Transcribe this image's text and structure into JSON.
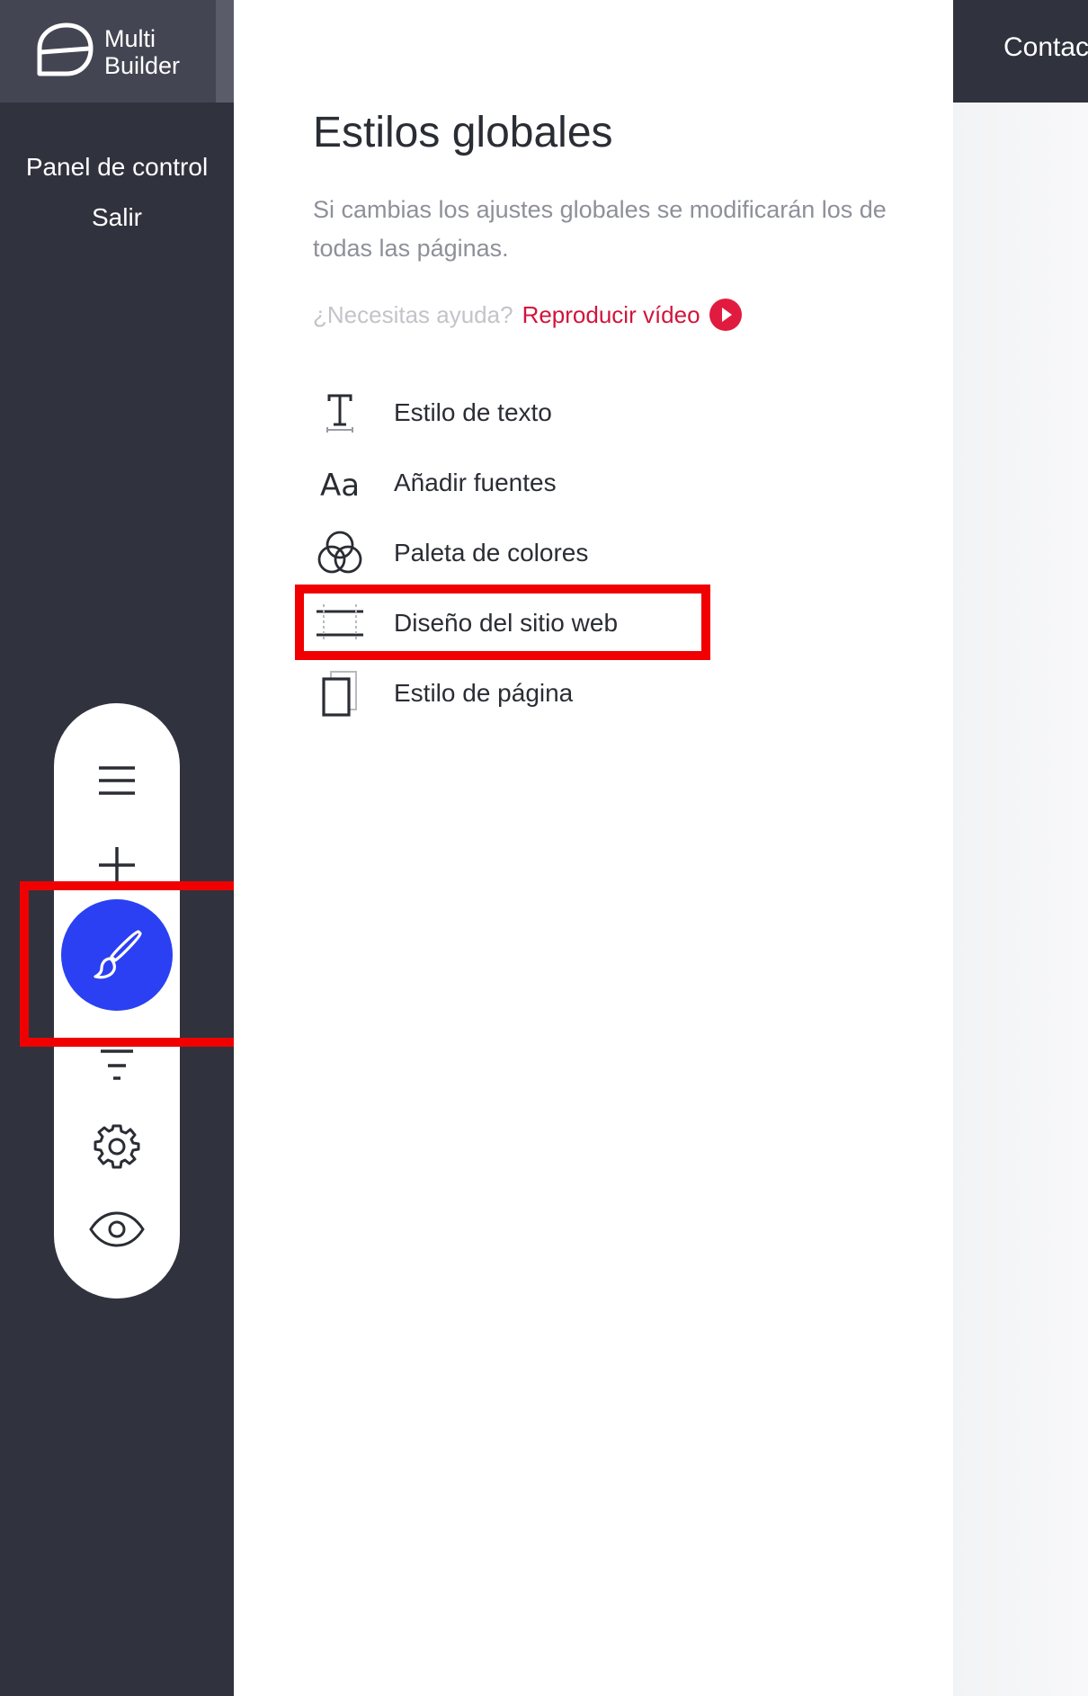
{
  "app": {
    "logo_line1": "Multi",
    "logo_line2": "Builder"
  },
  "sidebar": {
    "links": [
      {
        "label": "Panel de control"
      },
      {
        "label": "Salir"
      }
    ]
  },
  "toolbar": {
    "tools": [
      {
        "icon": "menu-icon"
      },
      {
        "icon": "plus-icon"
      },
      {
        "icon": "brush-icon",
        "active": true
      },
      {
        "icon": "filter-icon"
      },
      {
        "icon": "gear-icon"
      },
      {
        "icon": "eye-icon"
      }
    ],
    "active_color": "#2b40f2"
  },
  "panel": {
    "title": "Estilos globales",
    "description": "Si cambias los ajustes globales se modificarán los de todas las páginas.",
    "help_question": "¿Necesitas ayuda?",
    "help_link": "Reproducir vídeo",
    "items": [
      {
        "label": "Estilo de texto",
        "icon": "text-style-icon"
      },
      {
        "label": "Añadir fuentes",
        "icon": "fonts-icon"
      },
      {
        "label": "Paleta de colores",
        "icon": "color-palette-icon"
      },
      {
        "label": "Diseño del sitio web",
        "icon": "layout-icon",
        "highlighted": true
      },
      {
        "label": "Estilo de página",
        "icon": "page-style-icon"
      }
    ]
  },
  "preview": {
    "nav_label": "Contac"
  },
  "colors": {
    "sidebar": "#30323e",
    "accent_link": "#d2143b",
    "highlight": "#f00000"
  }
}
